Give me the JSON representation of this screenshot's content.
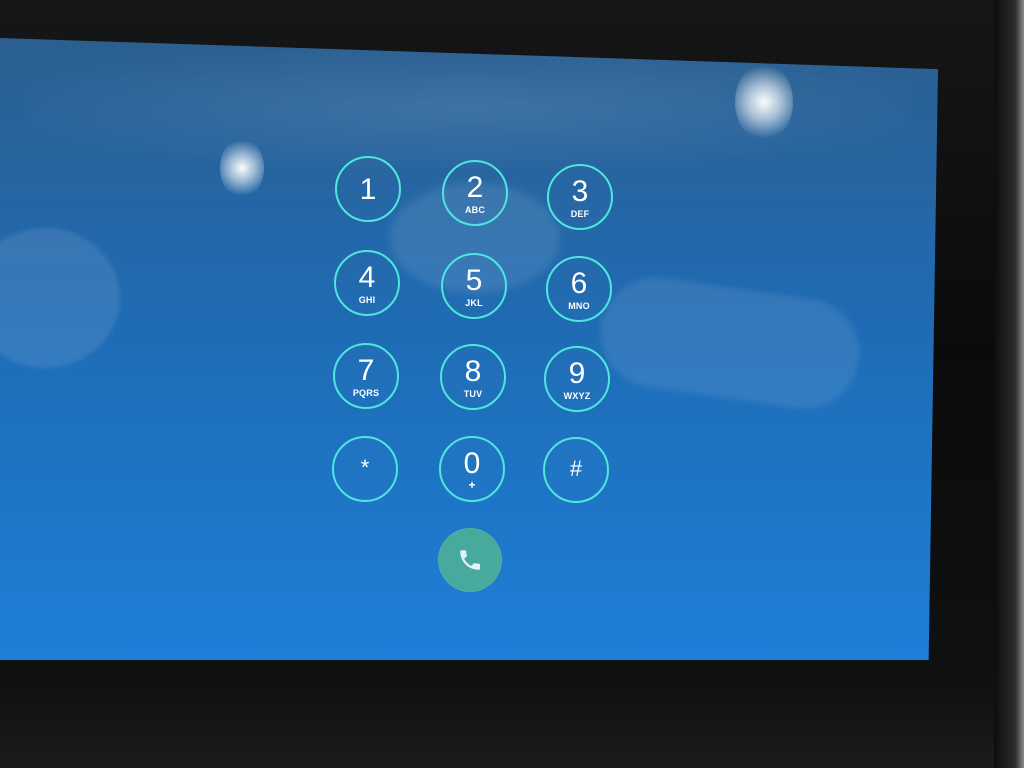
{
  "theme": {
    "key_ring_color": "#4fe6dc",
    "call_button_color": "#4caf98",
    "screen_top_color": "#2c5f90",
    "screen_bottom_color": "#1d7fd8"
  },
  "keypad": {
    "keys": [
      {
        "name": "key-1",
        "digit": "1",
        "letters": ""
      },
      {
        "name": "key-2",
        "digit": "2",
        "letters": "ABC"
      },
      {
        "name": "key-3",
        "digit": "3",
        "letters": "DEF"
      },
      {
        "name": "key-4",
        "digit": "4",
        "letters": "GHI"
      },
      {
        "name": "key-5",
        "digit": "5",
        "letters": "JKL"
      },
      {
        "name": "key-6",
        "digit": "6",
        "letters": "MNO"
      },
      {
        "name": "key-7",
        "digit": "7",
        "letters": "PQRS"
      },
      {
        "name": "key-8",
        "digit": "8",
        "letters": "TUV"
      },
      {
        "name": "key-9",
        "digit": "9",
        "letters": "WXYZ"
      },
      {
        "name": "key-star",
        "digit": "*",
        "letters": ""
      },
      {
        "name": "key-0",
        "digit": "0",
        "letters": "+"
      },
      {
        "name": "key-hash",
        "digit": "#",
        "letters": ""
      }
    ]
  },
  "call_button": {
    "icon": "phone-icon"
  }
}
